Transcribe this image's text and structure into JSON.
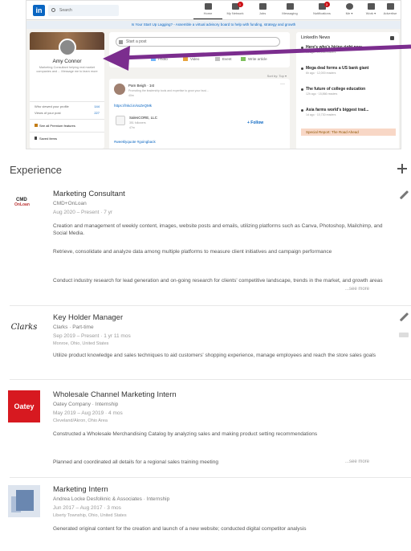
{
  "linkedin": {
    "logo": "in",
    "search_placeholder": "Search",
    "nav": [
      {
        "label": "Home",
        "icon": "home-icon",
        "badge": ""
      },
      {
        "label": "My Network",
        "icon": "network-icon",
        "badge": "1"
      },
      {
        "label": "Jobs",
        "icon": "jobs-icon",
        "badge": ""
      },
      {
        "label": "Messaging",
        "icon": "messaging-icon",
        "badge": ""
      },
      {
        "label": "Notifications",
        "icon": "bell-icon",
        "badge": "3"
      },
      {
        "label": "Me ▾",
        "icon": "avatar-icon",
        "badge": ""
      },
      {
        "label": "Work ▾",
        "icon": "grid-icon",
        "badge": ""
      },
      {
        "label": "Advertise",
        "icon": "advertise-icon",
        "badge": ""
      }
    ],
    "banner": "Is Your Start Up Lagging? - Assemble a virtual advisory board to help with funding, strategy and growth",
    "profile": {
      "name": "Amy Connor",
      "headline": "Marketing Consultant helping real market companies and ... Message me to learn more",
      "viewed_label": "Who viewed your profile",
      "viewed_value": "144",
      "views_label": "Views of your post",
      "views_value": "227",
      "premium": "See all Premium features",
      "saved": "Saved items"
    },
    "composer": {
      "start_post": "Start a post",
      "actions": [
        "Photo",
        "Video",
        "Event",
        "Write article"
      ],
      "sort_by": "Sort by: Top ▾"
    },
    "feed": {
      "author": "Pam Beigh · 1st",
      "author_sub": "Promoting the leadership tools and expertise to grow your busi...",
      "time": "40m",
      "link": "https://lnkd.in/ssZeQMk",
      "company": "SalesCORE, LLC",
      "company_sub": "351 followers",
      "company_time": "47m",
      "follow": "+ Follow",
      "hashtag": "#weeklyquote #goingback"
    },
    "news": {
      "title": "LinkedIn News",
      "items": [
        {
          "headline": "Here's who's hiring right now",
          "sub": "7h ago · 10,188 readers"
        },
        {
          "headline": "Mega deal forms a US bank giant",
          "sub": "6h ago · 12,000 readers"
        },
        {
          "headline": "The future of college education",
          "sub": "12h ago · 15,866 readers"
        },
        {
          "headline": "Asia farms world's biggest trad...",
          "sub": "1d ago · 10,730 readers"
        }
      ],
      "special": "Special Report: The Road Ahead"
    },
    "annotation_arrow_color": "#7b2d8e"
  },
  "experience": {
    "title": "Experience",
    "entries": [
      {
        "logo_text_1": "CMD",
        "logo_text_2": "OnLoan",
        "title": "Marketing Consultant",
        "company": "CMD+OnLoan",
        "dates": "Aug 2020 – Present · 7 yr",
        "desc": [
          "Creation and management of weekly content, images, website posts and emails, utilizing platforms such as Canva, Photoshop, Mailchimp, and Social Media.",
          "Retrieve, consolidate and analyze data among multiple platforms to measure client initiatives and campaign performance",
          "Conduct industry research for lead generation and on-going research for clients' competitive landscape, trends in the market, and growth areas"
        ],
        "see_more": "...see more"
      },
      {
        "logo_text_1": "Clarks",
        "title": "Key Holder Manager",
        "company": "Clarks · Part-time",
        "dates": "Sep 2019 – Present · 1 yr 11 mos",
        "location": "Monroe, Ohio, United States",
        "desc": [
          "Utilize product knowledge and sales techniques to aid customers' shopping experience, manage employees and reach the store sales goals"
        ]
      },
      {
        "logo_text_1": "Oatey",
        "title": "Wholesale Channel Marketing Intern",
        "company": "Oatey Company · Internship",
        "dates": "May 2019 – Aug 2019 · 4 mos",
        "location": "Cleveland/Akron, Ohio Area",
        "desc": [
          "Constructed a Wholesale Merchandising Catalog by analyzing sales and making product setting recommendations",
          "Planned and coordinated all details for a regional sales training meeting"
        ],
        "see_more": "...see more"
      },
      {
        "title": "Marketing Intern",
        "company": "Andrea Locke Desfolknic & Associates · Internship",
        "dates": "Jun 2017 – Aug 2017 · 3 mos",
        "location": "Liberty Township, Ohio, United States",
        "desc": [
          "Generated original content for the creation and launch of a new website; conducted digital competitor analysis"
        ]
      }
    ]
  }
}
